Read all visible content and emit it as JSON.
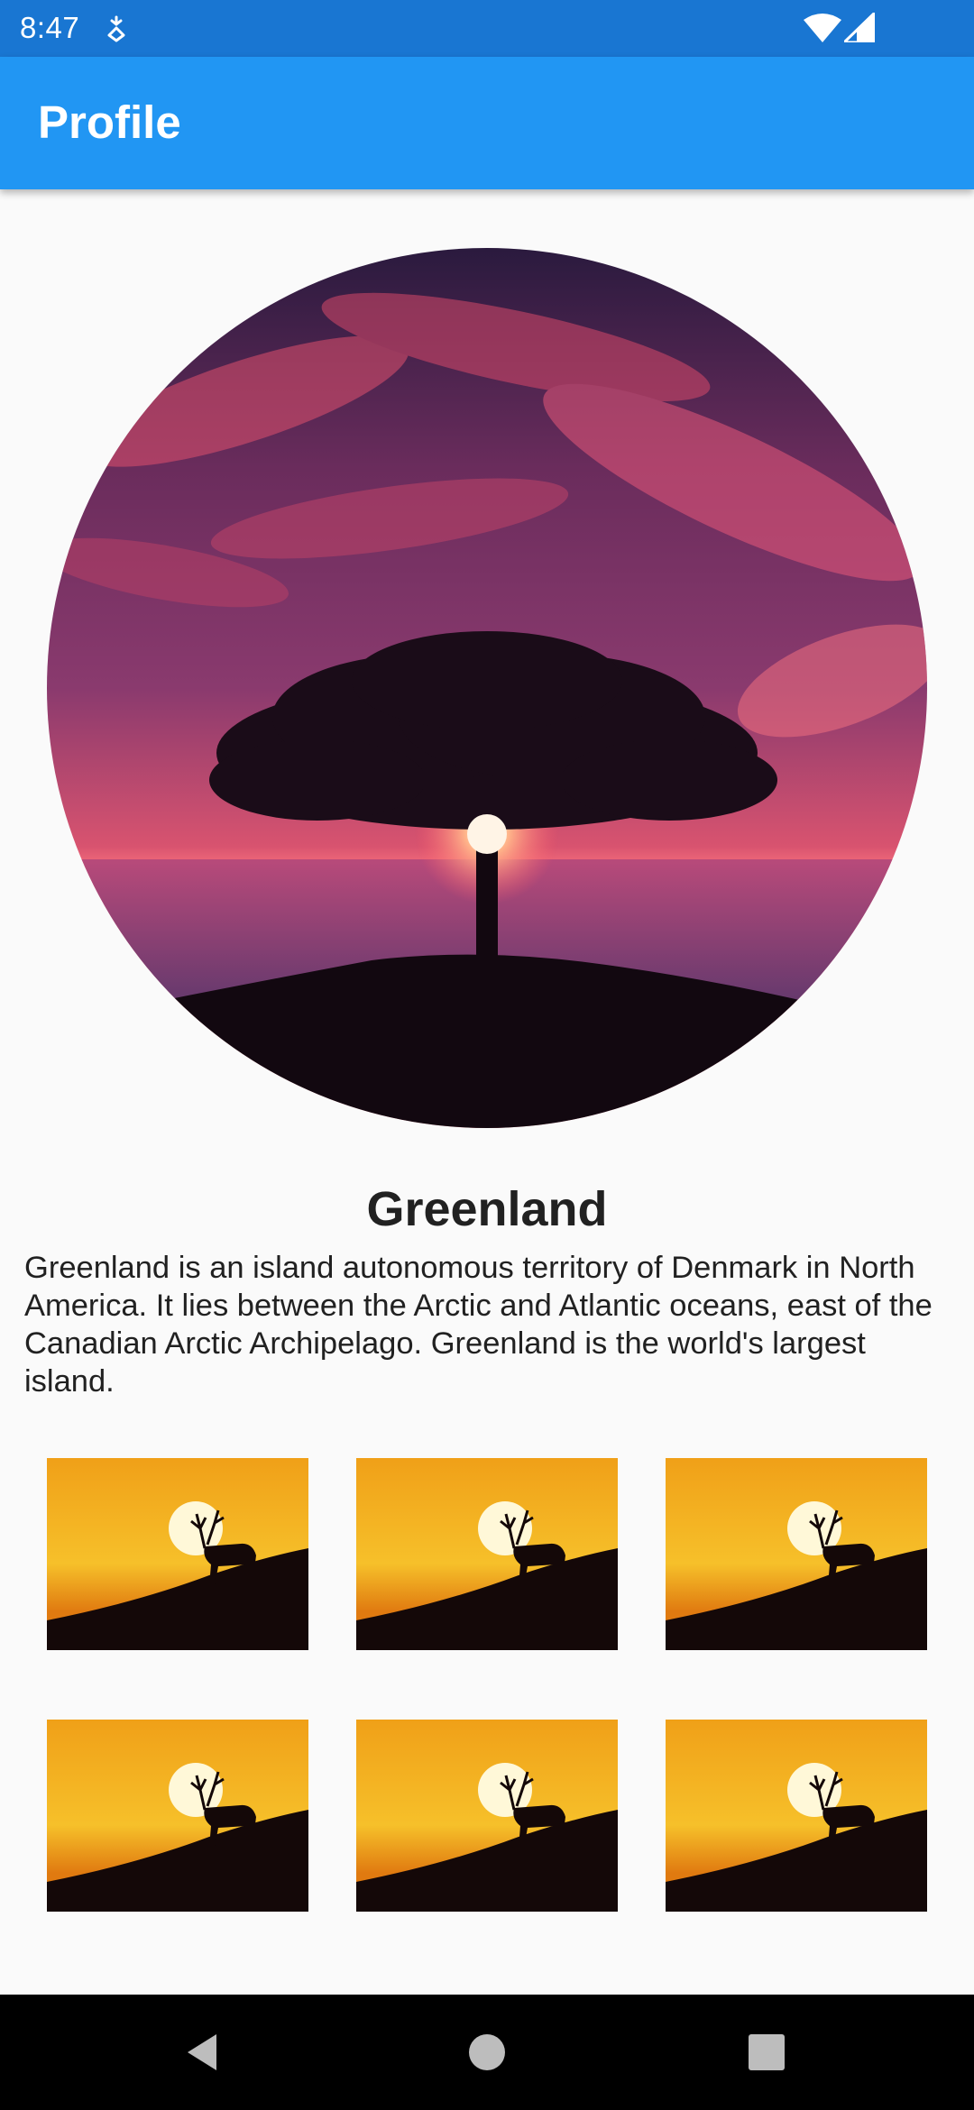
{
  "status_bar": {
    "time": "8:47",
    "icons": [
      "data-saver-icon",
      "wifi-icon",
      "cell-signal-icon"
    ]
  },
  "app_bar": {
    "title": "Profile"
  },
  "profile": {
    "image": "sunset-tree-photo",
    "name": "Greenland",
    "description": "Greenland is an island autonomous territory of Denmark in North America. It lies between the Arctic and Atlantic oceans, east of the Canadian Arctic Archipelago. Greenland is the world's largest island."
  },
  "gallery": {
    "image": "deer-sunset-photo",
    "count": 6
  },
  "nav_bar": {
    "icons": [
      "back-icon",
      "home-icon",
      "recents-icon"
    ]
  },
  "colors": {
    "status_bar": "#1976d2",
    "app_bar": "#2196f3",
    "background": "#fafafa",
    "text": "#212121"
  }
}
